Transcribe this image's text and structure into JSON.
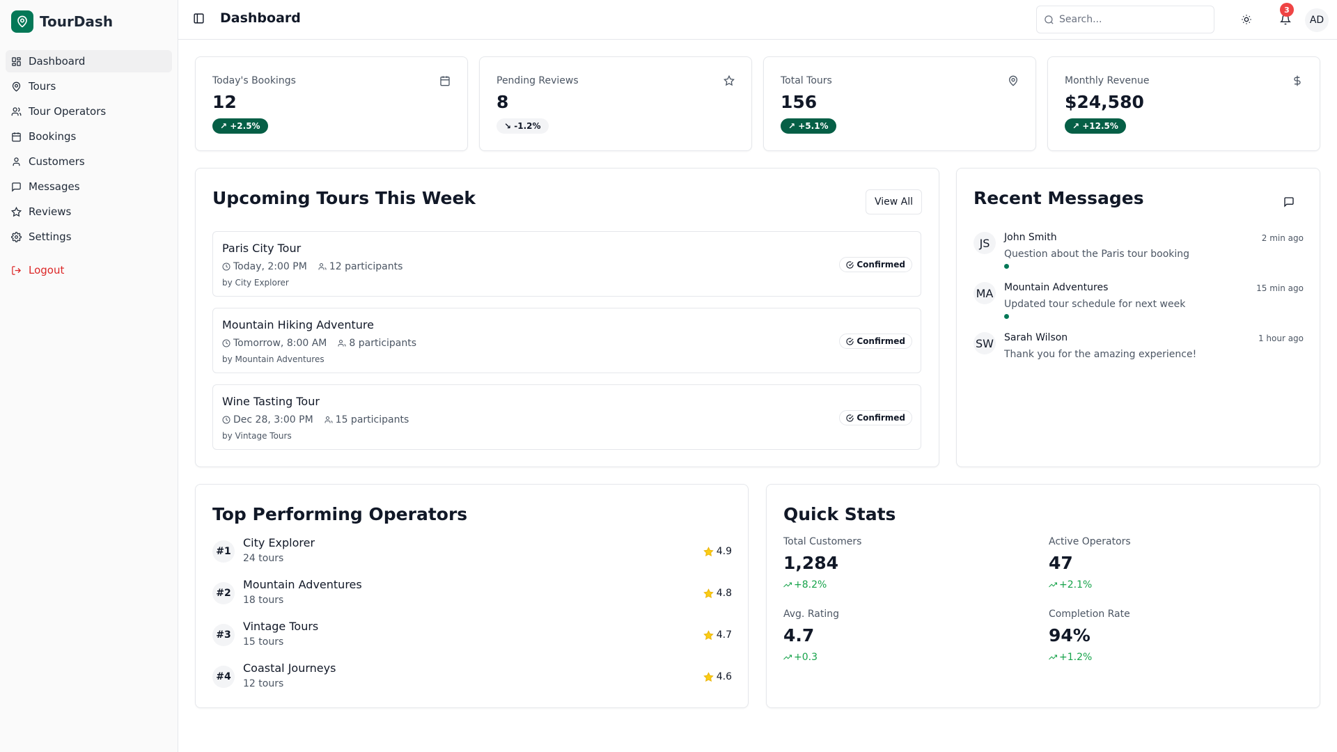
{
  "brand": {
    "name": "TourDash",
    "logo_icon": "map-pin-icon",
    "accent": "#047857"
  },
  "sidebar": {
    "items": [
      {
        "label": "Dashboard",
        "icon": "grid-icon",
        "active": true
      },
      {
        "label": "Tours",
        "icon": "map-pin-icon"
      },
      {
        "label": "Tour Operators",
        "icon": "users-icon"
      },
      {
        "label": "Bookings",
        "icon": "calendar-icon"
      },
      {
        "label": "Customers",
        "icon": "user-icon"
      },
      {
        "label": "Messages",
        "icon": "message-icon"
      },
      {
        "label": "Reviews",
        "icon": "star-icon"
      },
      {
        "label": "Settings",
        "icon": "gear-icon"
      }
    ],
    "logout_label": "Logout"
  },
  "header": {
    "title": "Dashboard",
    "search_placeholder": "Search...",
    "notification_count": "3",
    "avatar_initials": "AD"
  },
  "stats": [
    {
      "label": "Today's Bookings",
      "value": "12",
      "delta": "+2.5%",
      "trend": "up",
      "icon": "calendar-icon"
    },
    {
      "label": "Pending Reviews",
      "value": "8",
      "delta": "-1.2%",
      "trend": "down",
      "icon": "star-icon"
    },
    {
      "label": "Total Tours",
      "value": "156",
      "delta": "+5.1%",
      "trend": "up",
      "icon": "map-pin-icon"
    },
    {
      "label": "Monthly Revenue",
      "value": "$24,580",
      "delta": "+12.5%",
      "trend": "up",
      "icon": "dollar-icon"
    }
  ],
  "upcoming": {
    "title": "Upcoming Tours This Week",
    "view_all_label": "View All",
    "tours": [
      {
        "name": "Paris City Tour",
        "time": "Today, 2:00 PM",
        "participants": "12 participants",
        "operator": "by City Explorer",
        "status": "Confirmed"
      },
      {
        "name": "Mountain Hiking Adventure",
        "time": "Tomorrow, 8:00 AM",
        "participants": "8 participants",
        "operator": "by Mountain Adventures",
        "status": "Confirmed"
      },
      {
        "name": "Wine Tasting Tour",
        "time": "Dec 28, 3:00 PM",
        "participants": "15 participants",
        "operator": "by Vintage Tours",
        "status": "Confirmed"
      }
    ]
  },
  "messages": {
    "title": "Recent Messages",
    "items": [
      {
        "initials": "JS",
        "name": "John Smith",
        "time": "2 min ago",
        "text": "Question about the Paris tour booking",
        "unread": true
      },
      {
        "initials": "MA",
        "name": "Mountain Adventures",
        "time": "15 min ago",
        "text": "Updated tour schedule for next week",
        "unread": true
      },
      {
        "initials": "SW",
        "name": "Sarah Wilson",
        "time": "1 hour ago",
        "text": "Thank you for the amazing experience!",
        "unread": false
      }
    ]
  },
  "operators": {
    "title": "Top Performing Operators",
    "items": [
      {
        "rank": "#1",
        "name": "City Explorer",
        "tours": "24 tours",
        "rating": "4.9"
      },
      {
        "rank": "#2",
        "name": "Mountain Adventures",
        "tours": "18 tours",
        "rating": "4.8"
      },
      {
        "rank": "#3",
        "name": "Vintage Tours",
        "tours": "15 tours",
        "rating": "4.7"
      },
      {
        "rank": "#4",
        "name": "Coastal Journeys",
        "tours": "12 tours",
        "rating": "4.6"
      }
    ]
  },
  "quick_stats": {
    "title": "Quick Stats",
    "items": [
      {
        "label": "Total Customers",
        "value": "1,284",
        "delta": "+8.2%"
      },
      {
        "label": "Active Operators",
        "value": "47",
        "delta": "+2.1%"
      },
      {
        "label": "Avg. Rating",
        "value": "4.7",
        "delta": "+0.3"
      },
      {
        "label": "Completion Rate",
        "value": "94%",
        "delta": "+1.2%"
      }
    ]
  }
}
